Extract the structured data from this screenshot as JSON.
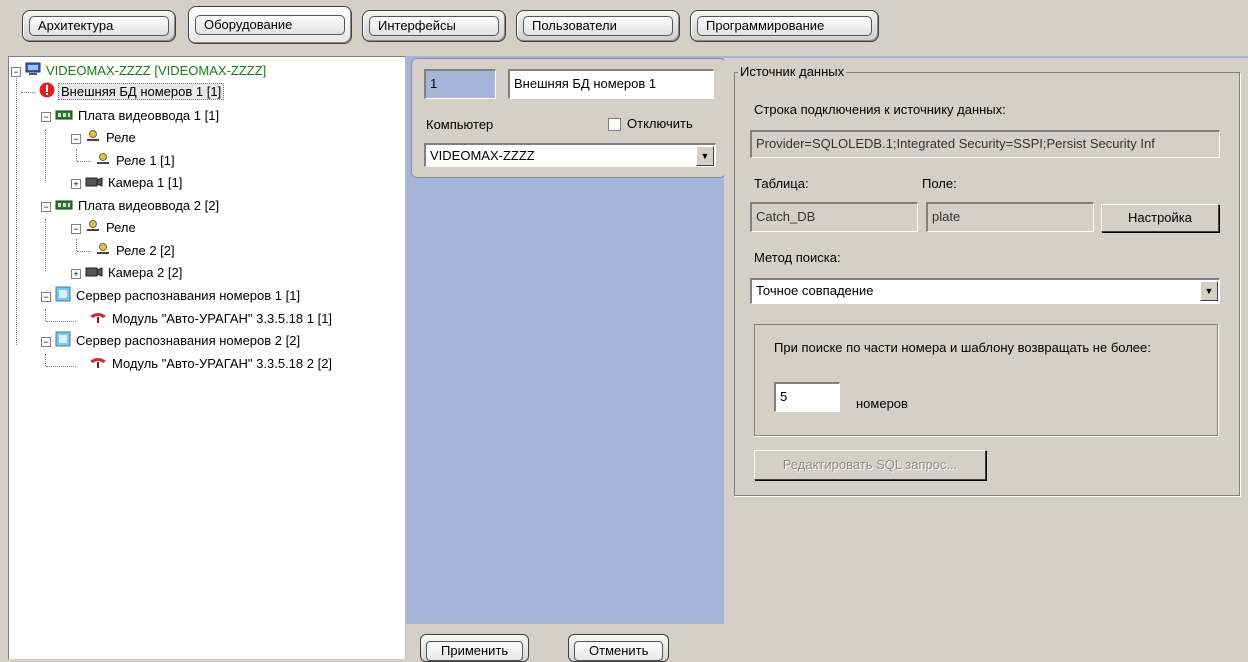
{
  "tabs": [
    {
      "label": "Архитектура",
      "active": false
    },
    {
      "label": "Оборудование",
      "active": true
    },
    {
      "label": "Интерфейсы",
      "active": false
    },
    {
      "label": "Пользователи",
      "active": false
    },
    {
      "label": "Программирование",
      "active": false
    }
  ],
  "tree": {
    "root": "VIDEOMAX-ZZZZ [VIDEOMAX-ZZZZ]",
    "items": [
      {
        "label": "Внешняя БД номеров 1 [1]",
        "icon": "error-icon"
      },
      {
        "label": "Плата видеоввода 1 [1]",
        "icon": "board-icon"
      },
      {
        "label": "Реле",
        "icon": "relay-icon"
      },
      {
        "label": "Реле 1 [1]",
        "icon": "relay-icon"
      },
      {
        "label": "Камера 1 [1]",
        "icon": "camera-icon"
      },
      {
        "label": "Плата видеоввода 2 [2]",
        "icon": "board-icon"
      },
      {
        "label": "Реле",
        "icon": "relay-icon"
      },
      {
        "label": "Реле 2 [2]",
        "icon": "relay-icon"
      },
      {
        "label": "Камера 2 [2]",
        "icon": "camera-icon"
      },
      {
        "label": "Сервер распознавания номеров 1 [1]",
        "icon": "server-icon"
      },
      {
        "label": "Модуль \"Авто-УРАГАН\" 3.3.5.18 1 [1]",
        "icon": "module-icon"
      },
      {
        "label": "Сервер распознавания номеров 2 [2]",
        "icon": "server-icon"
      },
      {
        "label": "Модуль \"Авто-УРАГАН\" 3.3.5.18 2 [2]",
        "icon": "module-icon"
      }
    ]
  },
  "object": {
    "id": "1",
    "name": "Внешняя БД номеров 1",
    "computer_label": "Компьютер",
    "disable_label": "Отключить",
    "disabled": false,
    "computer_value": "VIDEOMAX-ZZZZ"
  },
  "source": {
    "group_title": "Источник данных",
    "conn_label": "Строка подключения к источнику данных:",
    "conn_value": "Provider=SQLOLEDB.1;Integrated Security=SSPI;Persist Security Inf",
    "table_label": "Таблица:",
    "table_value": "Catch_DB",
    "field_label": "Поле:",
    "field_value": "plate",
    "setup_button": "Настройка",
    "method_label": "Метод поиска:",
    "method_value": "Точное совпадение",
    "partial_text": "При поиске по части номера и шаблону возвращать не более:",
    "partial_value": "5",
    "partial_unit": "номеров",
    "sql_button": "Редактировать SQL запрос..."
  },
  "bottom": {
    "apply": "Применить",
    "cancel": "Отменить"
  },
  "colors": {
    "window_bg": "#d4d0c8",
    "panel_blue": "#a4b5d8",
    "root_green": "#1a7a1a",
    "error_red": "#e02020"
  }
}
